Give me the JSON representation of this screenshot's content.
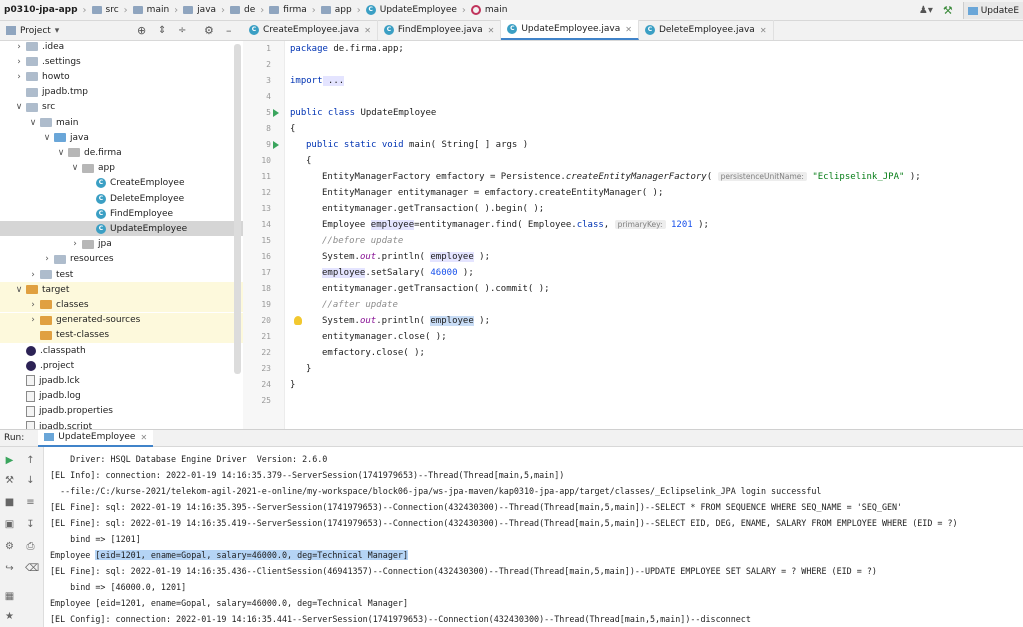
{
  "breadcrumb": [
    {
      "label": "p0310-jpa-app",
      "icon": "folder-icon"
    },
    {
      "label": "src",
      "icon": "folder-icon"
    },
    {
      "label": "main",
      "icon": "folder-icon"
    },
    {
      "label": "java",
      "icon": "folder-icon"
    },
    {
      "label": "de",
      "icon": "folder-icon"
    },
    {
      "label": "firma",
      "icon": "folder-icon"
    },
    {
      "label": "app",
      "icon": "folder-icon"
    },
    {
      "label": "UpdateEmployee",
      "icon": "class-icon"
    },
    {
      "label": "main",
      "icon": "method-icon"
    }
  ],
  "run_config": "UpdateE",
  "project_panel": {
    "title": "Project"
  },
  "tabs": [
    {
      "label": "CreateEmployee.java",
      "active": false
    },
    {
      "label": "FindEmployee.java",
      "active": false
    },
    {
      "label": "UpdateEmployee.java",
      "active": true
    },
    {
      "label": "DeleteEmployee.java",
      "active": false
    }
  ],
  "tree": [
    {
      "label": ".idea",
      "indent": 1,
      "arrow": ">",
      "icon": "folder"
    },
    {
      "label": ".settings",
      "indent": 1,
      "arrow": ">",
      "icon": "folder"
    },
    {
      "label": "howto",
      "indent": 1,
      "arrow": ">",
      "icon": "folder"
    },
    {
      "label": "jpadb.tmp",
      "indent": 1,
      "arrow": "",
      "icon": "folder"
    },
    {
      "label": "src",
      "indent": 1,
      "arrow": "v",
      "icon": "folder"
    },
    {
      "label": "main",
      "indent": 2,
      "arrow": "v",
      "icon": "folder"
    },
    {
      "label": "java",
      "indent": 3,
      "arrow": "v",
      "icon": "folder-blue"
    },
    {
      "label": "de.firma",
      "indent": 4,
      "arrow": "v",
      "icon": "package"
    },
    {
      "label": "app",
      "indent": 5,
      "arrow": "v",
      "icon": "package"
    },
    {
      "label": "CreateEmployee",
      "indent": 6,
      "arrow": "",
      "icon": "class"
    },
    {
      "label": "DeleteEmployee",
      "indent": 6,
      "arrow": "",
      "icon": "class"
    },
    {
      "label": "FindEmployee",
      "indent": 6,
      "arrow": "",
      "icon": "class"
    },
    {
      "label": "UpdateEmployee",
      "indent": 6,
      "arrow": "",
      "icon": "class",
      "selected": true
    },
    {
      "label": "jpa",
      "indent": 5,
      "arrow": ">",
      "icon": "package"
    },
    {
      "label": "resources",
      "indent": 3,
      "arrow": ">",
      "icon": "folder"
    },
    {
      "label": "test",
      "indent": 2,
      "arrow": ">",
      "icon": "folder"
    },
    {
      "label": "target",
      "indent": 1,
      "arrow": "v",
      "icon": "folder-orange",
      "excluded": true
    },
    {
      "label": "classes",
      "indent": 2,
      "arrow": ">",
      "icon": "folder-orange",
      "excluded": true
    },
    {
      "label": "generated-sources",
      "indent": 2,
      "arrow": ">",
      "icon": "folder-orange",
      "excluded": true
    },
    {
      "label": "test-classes",
      "indent": 2,
      "arrow": "",
      "icon": "folder-orange",
      "excluded": true
    },
    {
      "label": ".classpath",
      "indent": 1,
      "arrow": "",
      "icon": "eclipse"
    },
    {
      "label": ".project",
      "indent": 1,
      "arrow": "",
      "icon": "eclipse"
    },
    {
      "label": "jpadb.lck",
      "indent": 1,
      "arrow": "",
      "icon": "file"
    },
    {
      "label": "jpadb.log",
      "indent": 1,
      "arrow": "",
      "icon": "file"
    },
    {
      "label": "jpadb.properties",
      "indent": 1,
      "arrow": "",
      "icon": "file"
    },
    {
      "label": "jpadb.script",
      "indent": 1,
      "arrow": "",
      "icon": "file"
    }
  ],
  "code": {
    "line_numbers": [
      "1",
      "2",
      "3",
      "4",
      "5",
      "8",
      "9",
      "10",
      "11",
      "12",
      "13",
      "14",
      "15",
      "16",
      "17",
      "18",
      "19",
      "20",
      "21",
      "22",
      "23",
      "24",
      "25"
    ],
    "pkg_kw": "package",
    "pkg_name": " de.firma.app;",
    "import_kw": "import",
    "import_fold": " ...",
    "public_kw": "public",
    "class_kw": " class",
    "class_name": " UpdateEmployee",
    "brace_open": "{",
    "static_kw": " static",
    "void_kw": " void",
    "main_sig": " main( String[ ] args )",
    "l11_open": "{",
    "l12_a": "EntityManagerFactory emfactory = Persistence.",
    "l12_m": "createEntityManagerFactory",
    "l12_b": "( ",
    "l12_hint": "persistenceUnitName:",
    "l12_str": "\"Eclipselink_JPA\"",
    "l12_c": " );",
    "l13": "EntityManager entitymanager = emfactory.createEntityManager( );",
    "l14": "entitymanager.getTransaction( ).begin( );",
    "l15_a": "Employee ",
    "l15_var": "employee",
    "l15_b": "=entitymanager.find( Employee.",
    "l15_kw": "class",
    "l15_c": ", ",
    "l15_hint": "primaryKey:",
    "l15_num": "1201",
    "l15_d": " );",
    "l16_cm": "//before update",
    "l17_a": "System.",
    "l17_out": "out",
    "l17_b": ".println( ",
    "l17_var": "employee",
    "l17_c": " );",
    "l18_var": "employee",
    "l18_a": ".setSalary( ",
    "l18_num": "46000",
    "l18_b": " );",
    "l19": "entitymanager.getTransaction( ).commit( );",
    "l20_cm": "//after update",
    "l21_a": "System.",
    "l21_out": "out",
    "l21_b": ".println( ",
    "l21_var": "employee",
    "l21_c": " );",
    "l22": "entitymanager.close( );",
    "l23": "emfactory.close( );",
    "l24": "}",
    "l25": "}"
  },
  "run": {
    "label": "Run:",
    "tab": "UpdateEmployee"
  },
  "console": [
    "    Driver: HSQL Database Engine Driver  Version: 2.6.0",
    "[EL Info]: connection: 2022-01-19 14:16:35.379--ServerSession(1741979653)--Thread(Thread[main,5,main])",
    "  --file:/C:/kurse-2021/telekom-agil-2021-e-online/my-workspace/block06-jpa/ws-jpa-maven/kap0310-jpa-app/target/classes/_Eclipselink_JPA login successful",
    "[EL Fine]: sql: 2022-01-19 14:16:35.395--ServerSession(1741979653)--Connection(432430300)--Thread(Thread[main,5,main])--SELECT * FROM SEQUENCE WHERE SEQ_NAME = 'SEQ_GEN'",
    "[EL Fine]: sql: 2022-01-19 14:16:35.419--ServerSession(1741979653)--Connection(432430300)--Thread(Thread[main,5,main])--SELECT EID, DEG, ENAME, SALARY FROM EMPLOYEE WHERE (EID = ?)",
    "    bind => [1201]",
    "",
    "[EL Fine]: sql: 2022-01-19 14:16:35.436--ClientSession(46941357)--Connection(432430300)--Thread(Thread[main,5,main])--UPDATE EMPLOYEE SET SALARY = ? WHERE (EID = ?)",
    "    bind => [46000.0, 1201]",
    "Employee [eid=1201, ename=Gopal, salary=46000.0, deg=Technical Manager]",
    "[EL Config]: connection: 2022-01-19 14:16:35.441--ServerSession(1741979653)--Connection(432430300)--Thread(Thread[main,5,main])--disconnect"
  ],
  "console_line7": {
    "prefix": "Employee ",
    "selected": "[eid=1201, ename=Gopal, salary=46000.0, deg=Technical Manager]"
  }
}
